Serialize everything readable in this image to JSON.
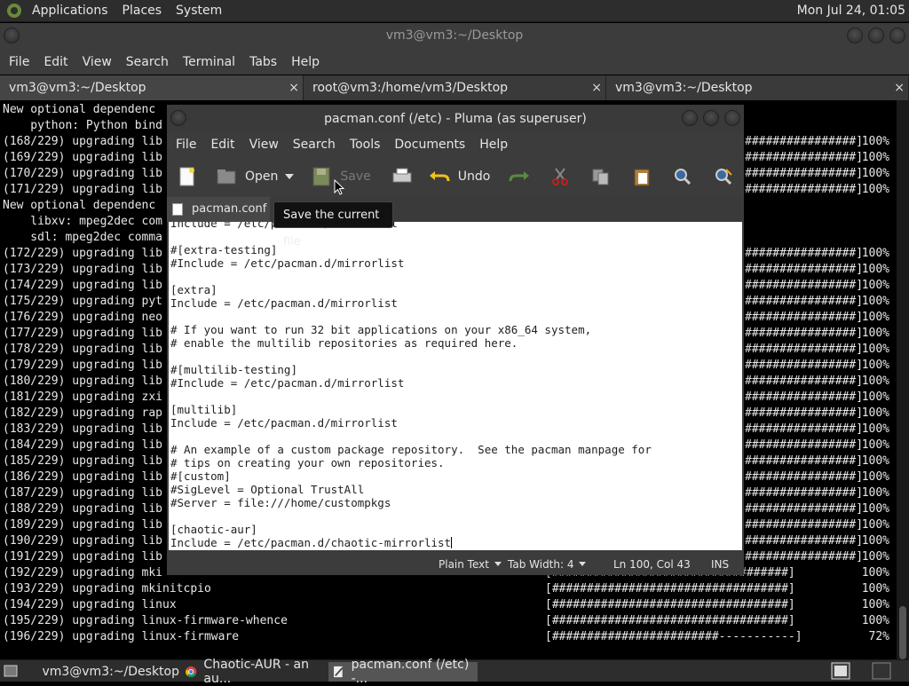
{
  "top_panel": {
    "menus": [
      "Applications",
      "Places",
      "System"
    ],
    "clock": "Mon Jul 24, 01:05"
  },
  "terminal": {
    "title": "vm3@vm3:~/Desktop",
    "menu": [
      "File",
      "Edit",
      "View",
      "Search",
      "Terminal",
      "Tabs",
      "Help"
    ],
    "tabs": [
      {
        "label": "vm3@vm3:~/Desktop",
        "close": "×"
      },
      {
        "label": "root@vm3:/home/vm3/Desktop",
        "close": "×"
      },
      {
        "label": "vm3@vm3:~/Desktop",
        "close": "×"
      }
    ],
    "lines": [
      {
        "text": "New optional dependenc",
        "prog": "",
        "pct": ""
      },
      {
        "text": "    python: Python bind",
        "prog": "",
        "pct": ""
      },
      {
        "text": "(168/229) upgrading lib",
        "prog": "################]",
        "pct": "100%"
      },
      {
        "text": "(169/229) upgrading lib",
        "prog": "################]",
        "pct": "100%"
      },
      {
        "text": "(170/229) upgrading lib",
        "prog": "################]",
        "pct": "100%"
      },
      {
        "text": "(171/229) upgrading lib",
        "prog": "################]",
        "pct": "100%"
      },
      {
        "text": "New optional dependenc",
        "prog": "",
        "pct": ""
      },
      {
        "text": "    libxv: mpeg2dec com",
        "prog": "",
        "pct": ""
      },
      {
        "text": "    sdl: mpeg2dec comma",
        "prog": "",
        "pct": ""
      },
      {
        "text": "(172/229) upgrading lib",
        "prog": "################]",
        "pct": "100%"
      },
      {
        "text": "(173/229) upgrading lib",
        "prog": "################]",
        "pct": "100%"
      },
      {
        "text": "(174/229) upgrading lib",
        "prog": "################]",
        "pct": "100%"
      },
      {
        "text": "(175/229) upgrading pyt",
        "prog": "################]",
        "pct": "100%"
      },
      {
        "text": "(176/229) upgrading neo",
        "prog": "################]",
        "pct": "100%"
      },
      {
        "text": "(177/229) upgrading lib",
        "prog": "################]",
        "pct": "100%"
      },
      {
        "text": "(178/229) upgrading lib",
        "prog": "################]",
        "pct": "100%"
      },
      {
        "text": "(179/229) upgrading lib",
        "prog": "################]",
        "pct": "100%"
      },
      {
        "text": "(180/229) upgrading lib",
        "prog": "################]",
        "pct": "100%"
      },
      {
        "text": "(181/229) upgrading zxi",
        "prog": "################]",
        "pct": "100%"
      },
      {
        "text": "(182/229) upgrading rap",
        "prog": "################]",
        "pct": "100%"
      },
      {
        "text": "(183/229) upgrading lib",
        "prog": "################]",
        "pct": "100%"
      },
      {
        "text": "(184/229) upgrading lib",
        "prog": "################]",
        "pct": "100%"
      },
      {
        "text": "(185/229) upgrading lib",
        "prog": "################]",
        "pct": "100%"
      },
      {
        "text": "(186/229) upgrading lib",
        "prog": "################]",
        "pct": "100%"
      },
      {
        "text": "(187/229) upgrading lib",
        "prog": "################]",
        "pct": "100%"
      },
      {
        "text": "(188/229) upgrading lib",
        "prog": "################]",
        "pct": "100%"
      },
      {
        "text": "(189/229) upgrading lib",
        "prog": "################]",
        "pct": "100%"
      },
      {
        "text": "(190/229) upgrading lib",
        "prog": "################]",
        "pct": "100%"
      },
      {
        "text": "(191/229) upgrading lib",
        "prog": "################]",
        "pct": "100%"
      },
      {
        "text": "(192/229) upgrading mki",
        "prog": "[##################################]",
        "pct": "100%"
      },
      {
        "text": "(193/229) upgrading mkinitcpio",
        "prog": "[##################################]",
        "pct": "100%"
      },
      {
        "text": "(194/229) upgrading linux",
        "prog": "[##################################]",
        "pct": "100%"
      },
      {
        "text": "(195/229) upgrading linux-firmware-whence",
        "prog": "[##################################]",
        "pct": "100%"
      },
      {
        "text": "(196/229) upgrading linux-firmware",
        "prog": "[########################-----------]",
        "pct": "72%"
      }
    ]
  },
  "pluma": {
    "title": "pacman.conf (/etc) - Pluma (as superuser)",
    "menu": [
      "File",
      "Edit",
      "View",
      "Search",
      "Tools",
      "Documents",
      "Help"
    ],
    "toolbar": {
      "open_label": "Open",
      "save_label": "Save",
      "undo_label": "Undo"
    },
    "doc_tab": "pacman.conf",
    "editor_lines": [
      "Include = /etc/pacman.d/mirrorlist",
      "",
      "#[extra-testing]",
      "#Include = /etc/pacman.d/mirrorlist",
      "",
      "[extra]",
      "Include = /etc/pacman.d/mirrorlist",
      "",
      "# If you want to run 32 bit applications on your x86_64 system,",
      "# enable the multilib repositories as required here.",
      "",
      "#[multilib-testing]",
      "#Include = /etc/pacman.d/mirrorlist",
      "",
      "[multilib]",
      "Include = /etc/pacman.d/mirrorlist",
      "",
      "# An example of a custom package repository.  See the pacman manpage for",
      "# tips on creating your own repositories.",
      "#[custom]",
      "#SigLevel = Optional TrustAll",
      "#Server = file:///home/custompkgs",
      "",
      "[chaotic-aur]",
      "Include = /etc/pacman.d/chaotic-mirrorlist"
    ],
    "status": {
      "syntax": "Plain Text",
      "tab_width": "Tab Width:  4",
      "position": "Ln 100, Col 43",
      "mode": "INS"
    }
  },
  "tooltip": "Save the current file",
  "taskbar": {
    "tasks": [
      {
        "label": "vm3@vm3:~/Desktop",
        "icon": "terminal-icon"
      },
      {
        "label": "Chaotic-AUR - an au...",
        "icon": "chrome-icon"
      },
      {
        "label": "pacman.conf (/etc) -...",
        "icon": "pluma-icon"
      }
    ]
  }
}
